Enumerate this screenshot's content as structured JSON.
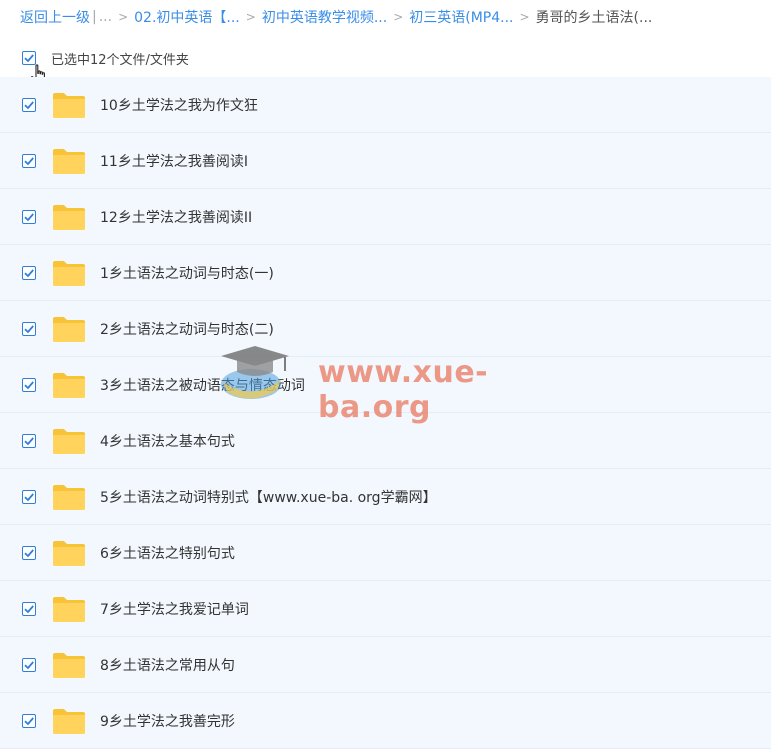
{
  "breadcrumb": {
    "back_label": "返回上一级",
    "sep_bar": "|",
    "ellipsis": "...",
    "items": [
      "02.初中英语【...",
      "初中英语教学视频...",
      "初三英语(MP4...",
      "勇哥的乡土语法(..."
    ]
  },
  "selection": {
    "label": "已选中12个文件/文件夹"
  },
  "files": [
    {
      "name": "10乡土学法之我为作文狂"
    },
    {
      "name": "11乡土学法之我善阅读I"
    },
    {
      "name": "12乡土学法之我善阅读II"
    },
    {
      "name": "1乡土语法之动词与时态(一)"
    },
    {
      "name": "2乡土语法之动词与时态(二)"
    },
    {
      "name": "3乡土语法之被动语态与情态动词"
    },
    {
      "name": "4乡土语法之基本句式"
    },
    {
      "name": "5乡土语法之动词特别式【www.xue-ba. org学霸网】"
    },
    {
      "name": "6乡土语法之特别句式"
    },
    {
      "name": "7乡土学法之我爱记单词"
    },
    {
      "name": "8乡土语法之常用从句"
    },
    {
      "name": "9乡土学法之我善完形"
    }
  ],
  "watermark": {
    "text": "www.xue-ba.org"
  },
  "icons": {
    "folder": "folder-icon",
    "check": "checkmark-icon",
    "cursor": "hand-cursor-icon",
    "logo": "graduation-cap-icon"
  },
  "colors": {
    "accent": "#3a8ee6",
    "row_bg": "#f3f8fe",
    "folder": "#ffd35c"
  }
}
